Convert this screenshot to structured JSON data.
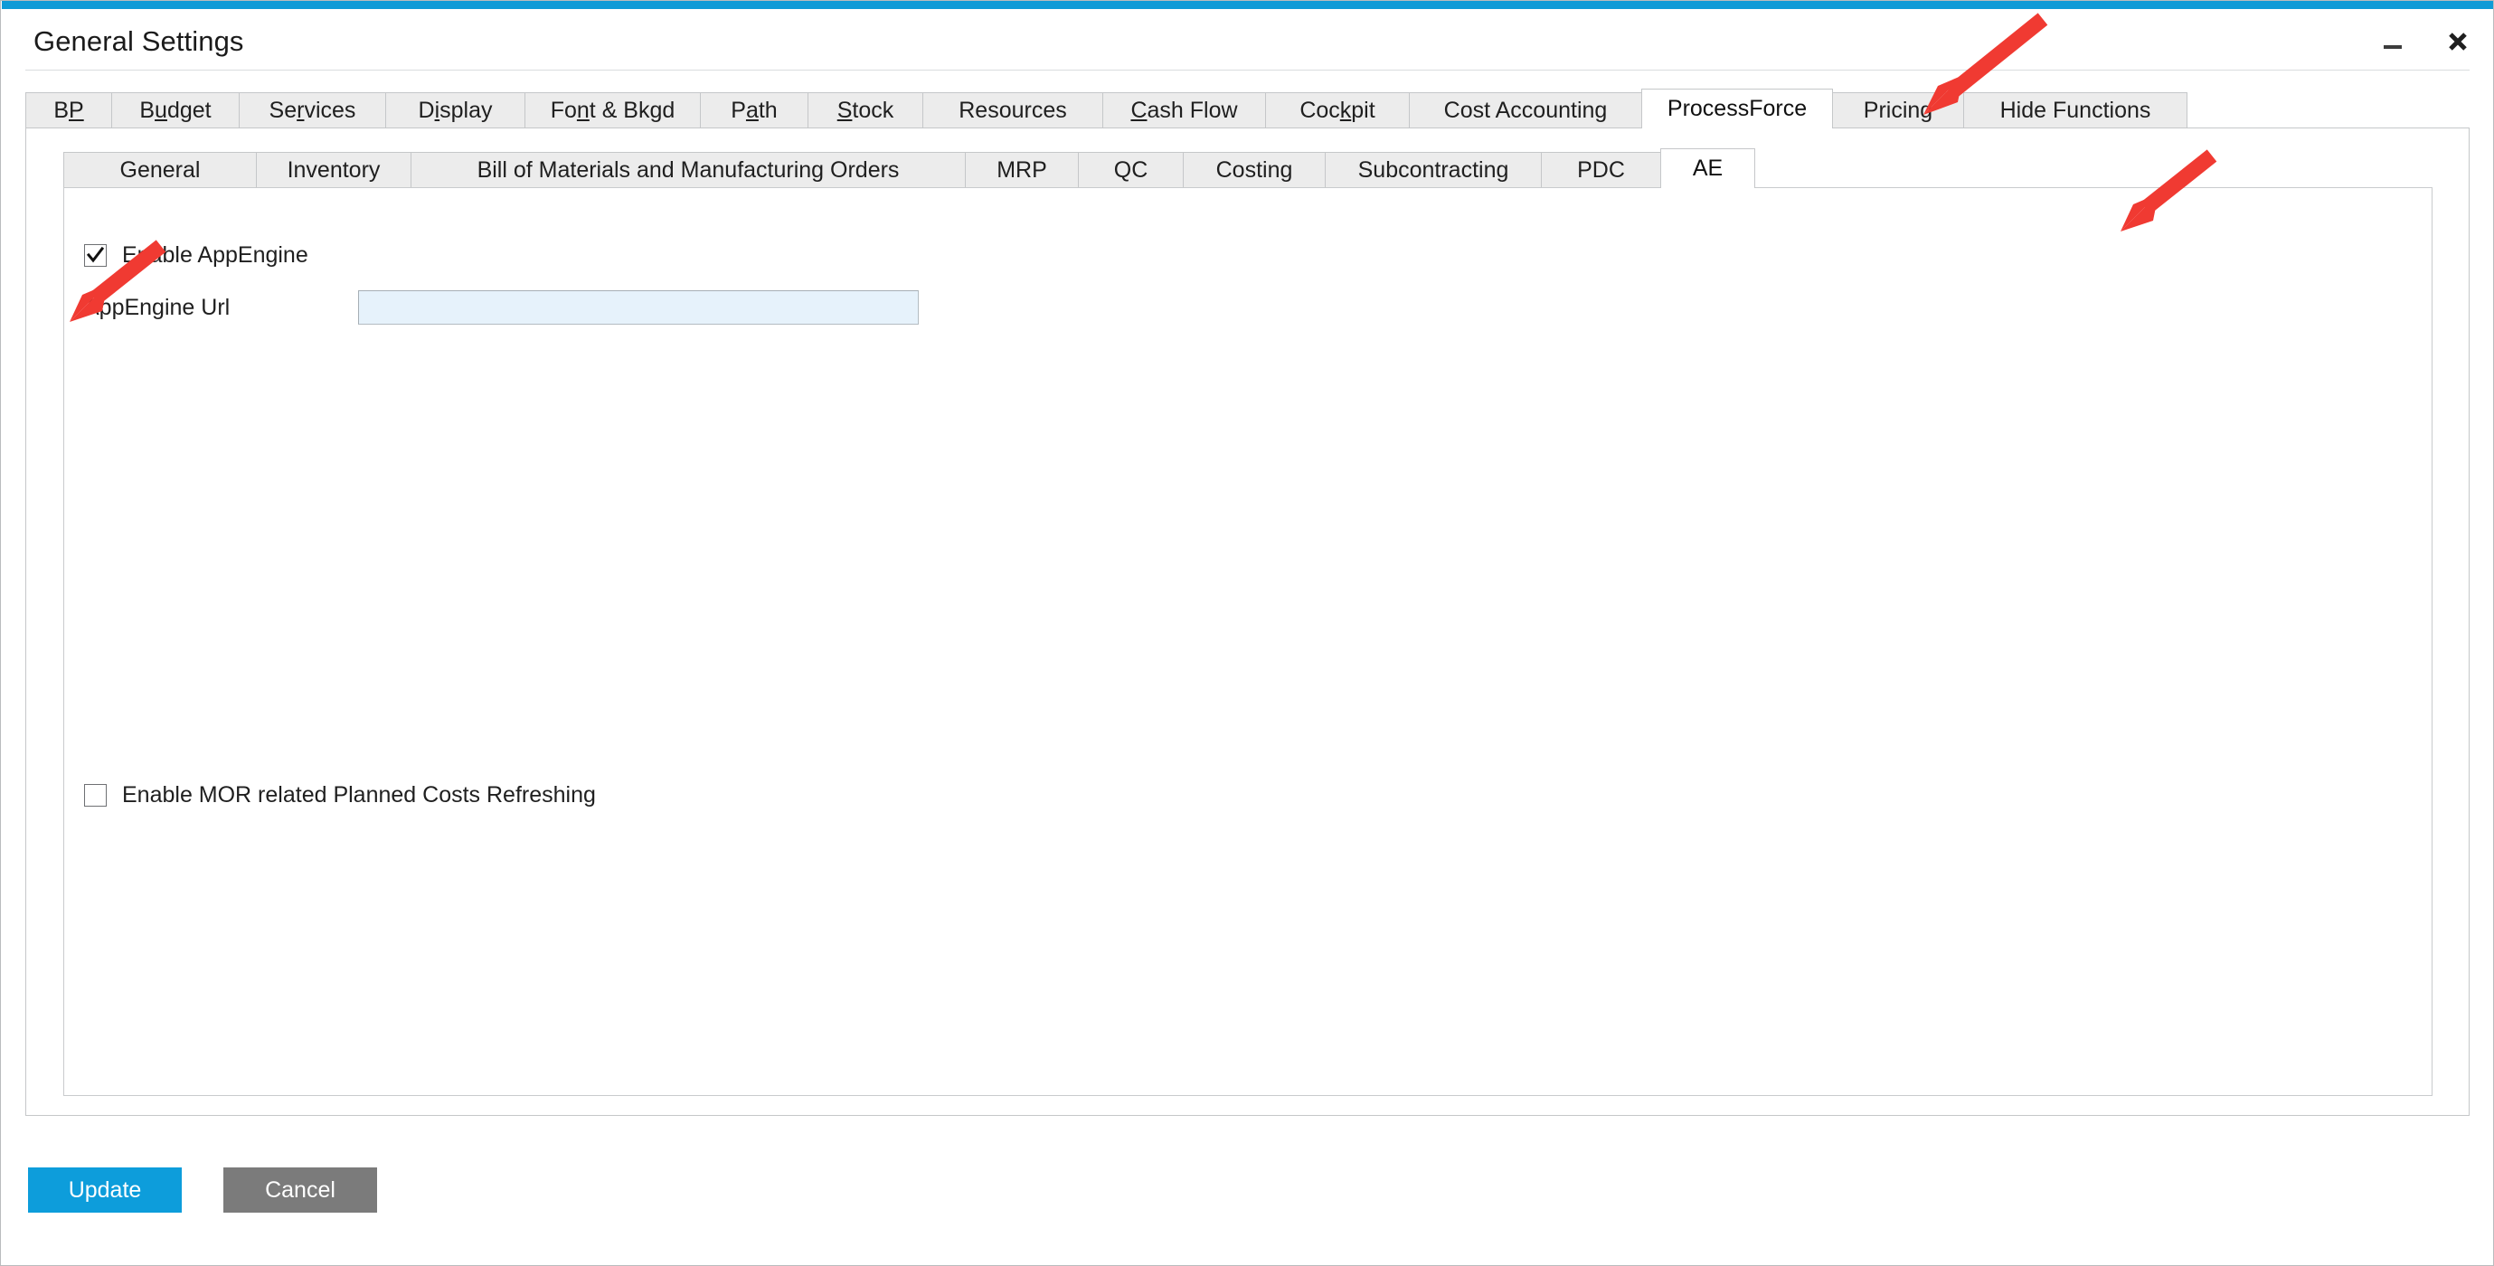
{
  "window": {
    "title": "General Settings",
    "accent_color": "#0f9bd7",
    "controls": [
      {
        "name": "minimize",
        "icon": "minimize-icon"
      },
      {
        "name": "close",
        "icon": "close-icon"
      }
    ]
  },
  "tabs_outer": {
    "active": "ProcessForce",
    "items": [
      {
        "label": "BP",
        "pre": "B",
        "acc": "P",
        "post": ""
      },
      {
        "label": "Budget",
        "pre": "B",
        "acc": "u",
        "post": "dget"
      },
      {
        "label": "Services",
        "pre": "Se",
        "acc": "r",
        "post": "vices"
      },
      {
        "label": "Display",
        "pre": "D",
        "acc": "i",
        "post": "splay"
      },
      {
        "label": "Font & Bkgd",
        "pre": "Fo",
        "acc": "n",
        "post": "t & Bkgd"
      },
      {
        "label": "Path",
        "pre": "P",
        "acc": "a",
        "post": "th"
      },
      {
        "label": "Stock",
        "pre": "",
        "acc": "S",
        "post": "tock"
      },
      {
        "label": "Resources",
        "pre": "Resources",
        "acc": "",
        "post": ""
      },
      {
        "label": "Cash Flow",
        "pre": "",
        "acc": "C",
        "post": "ash Flow"
      },
      {
        "label": "Cockpit",
        "pre": "Coc",
        "acc": "k",
        "post": "pit"
      },
      {
        "label": "Cost Accounting",
        "pre": "Cost Accounting",
        "acc": "",
        "post": ""
      },
      {
        "label": "ProcessForce",
        "pre": "ProcessForce",
        "acc": "",
        "post": ""
      },
      {
        "label": "Pricing",
        "pre": "Pricing",
        "acc": "",
        "post": ""
      },
      {
        "label": "Hide Functions",
        "pre": "Hide Functions",
        "acc": "",
        "post": ""
      }
    ]
  },
  "tabs_inner": {
    "active": "AE",
    "items": [
      {
        "label": "General"
      },
      {
        "label": "Inventory"
      },
      {
        "label": "Bill of Materials and Manufacturing Orders"
      },
      {
        "label": "MRP"
      },
      {
        "label": "QC"
      },
      {
        "label": "Costing"
      },
      {
        "label": "Subcontracting"
      },
      {
        "label": "PDC"
      },
      {
        "label": "AE"
      }
    ]
  },
  "form": {
    "enable_appengine": {
      "label": "Enable AppEngine",
      "checked": true
    },
    "appengine_url": {
      "label": "AppEngine Url",
      "value": "",
      "placeholder": ""
    },
    "enable_mor": {
      "label": "Enable MOR related Planned Costs Refreshing",
      "checked": false
    }
  },
  "footer": {
    "update_label": "Update",
    "cancel_label": "Cancel",
    "update_color": "#0d9ddb",
    "cancel_color": "#7b7b7b"
  },
  "annotations": {
    "arrow_color": "#f03a32",
    "arrows": [
      {
        "name": "arrow-to-processforce-tab",
        "points_to": "ProcessForce"
      },
      {
        "name": "arrow-to-ae-tab",
        "points_to": "AE"
      },
      {
        "name": "arrow-to-enable-appengine-checkbox",
        "points_to": "Enable AppEngine"
      }
    ]
  }
}
